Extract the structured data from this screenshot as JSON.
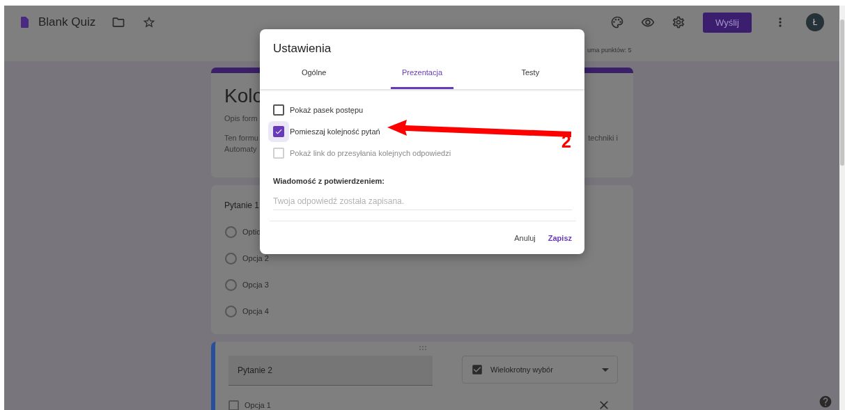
{
  "header": {
    "title": "Blank Quiz",
    "send_button": "Wyślij",
    "avatar": "Ł",
    "points": "uma punktów: 5"
  },
  "form_header": {
    "title": "Kolo",
    "description": "Opis form",
    "text_lines": [
      "Ten formu",
      "Automaty"
    ],
    "text_right": "techniki i"
  },
  "question_1": {
    "title": "Pytanie 1",
    "options": [
      {
        "label": "Optio",
        "selected": false
      },
      {
        "label": "Opcja 2",
        "selected": false
      },
      {
        "label": "Opcja 3",
        "selected": false
      },
      {
        "label": "Opcja 4",
        "selected": false
      }
    ]
  },
  "question_2": {
    "title": "Pytanie 2",
    "type": "Wielokrotny wybór",
    "options": [
      {
        "label": "Opcja 1",
        "checked": false
      }
    ]
  },
  "dialog": {
    "title": "Ustawienia",
    "tabs": [
      {
        "label": "Ogólne",
        "selected": false
      },
      {
        "label": "Prezentacja",
        "selected": true
      },
      {
        "label": "Testy",
        "selected": false
      }
    ],
    "checkboxes": [
      {
        "label": "Pokaż pasek postępu",
        "checked": false,
        "disabled": false
      },
      {
        "label": "Pomieszaj kolejność pytań",
        "checked": true,
        "disabled": false
      },
      {
        "label": "Pokaż link do przesyłania kolejnych odpowiedzi",
        "checked": false,
        "disabled": true
      }
    ],
    "confirmation_label": "Wiadomość z potwierdzeniem:",
    "confirmation_placeholder": "Twoja odpowiedź została zapisana.",
    "buttons": [
      {
        "label": "Anuluj",
        "kind": "secondary"
      },
      {
        "label": "Zapisz",
        "kind": "primary"
      }
    ]
  },
  "annotation": {
    "number": "2"
  }
}
